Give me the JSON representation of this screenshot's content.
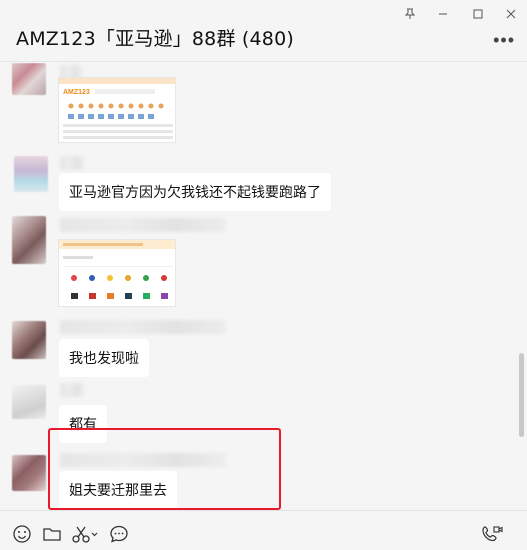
{
  "window": {
    "title": "AMZ123「亚马逊」88群 (480)",
    "pin_icon": "pin-icon",
    "minimize_icon": "minimize-icon",
    "maximize_icon": "maximize-icon",
    "close_icon": "close-icon",
    "more_icon": "more-icon"
  },
  "messages": [
    {
      "type": "image",
      "content": "screenshot-thumbnail"
    },
    {
      "type": "text",
      "text": "亚马逊官方因为欠我钱还不起钱要跑路了"
    },
    {
      "type": "image",
      "content": "screenshot-thumbnail"
    },
    {
      "type": "text",
      "text": "我也发现啦"
    },
    {
      "type": "text",
      "text": "都有"
    },
    {
      "type": "text",
      "text": "姐夫要迁那里去"
    }
  ],
  "toolbar": {
    "icons": [
      "emoji-icon",
      "folder-icon",
      "scissors-icon",
      "chat-bubble-icon",
      "video-call-icon"
    ]
  },
  "colors": {
    "background": "#f5f5f5",
    "bubble": "#ffffff",
    "highlight": "#e8192c"
  }
}
